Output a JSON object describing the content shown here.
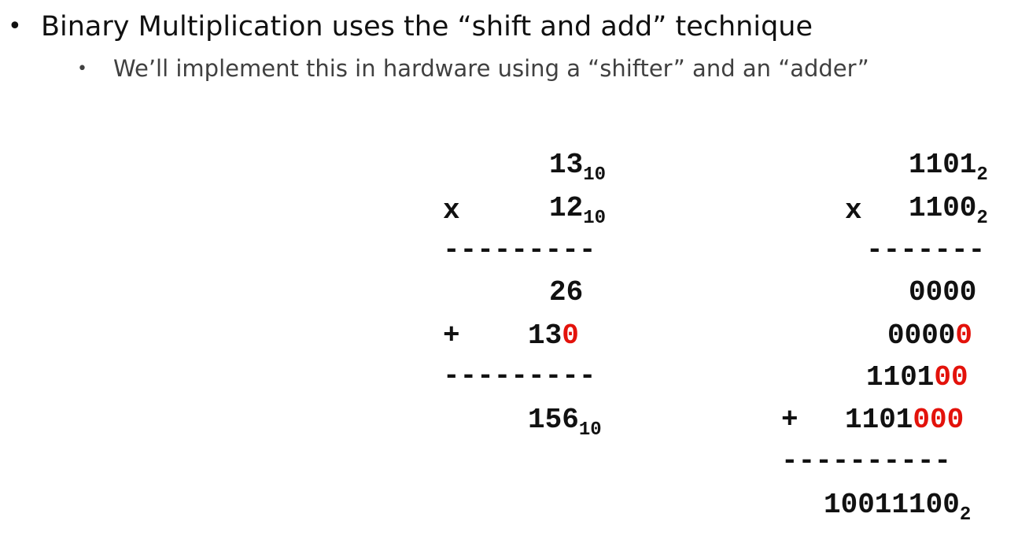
{
  "bullets": {
    "main": "Binary Multiplication uses the “shift and add” technique",
    "sub": "We’ll implement this in hardware using a “shifter” and an “adder”"
  },
  "decimal": {
    "multiplicand": "13",
    "multiplicand_base": "10",
    "times_sign": "x",
    "multiplier": "12",
    "multiplier_base": "10",
    "rule1": "---------",
    "partial1": "26",
    "plus_sign": "+",
    "partial2_digits": "13",
    "partial2_shift": "0",
    "rule2": "---------",
    "result": "156",
    "result_base": "10"
  },
  "binary": {
    "multiplicand": "1101",
    "multiplicand_base": "2",
    "times_sign": "x",
    "multiplier": "1100",
    "multiplier_base": "2",
    "rule1": "-------",
    "partial1": "0000",
    "partial2_digits": "0000",
    "partial2_shift": "0",
    "partial3_digits": "1101",
    "partial3_shift": "00",
    "plus_sign": "+",
    "partial4_digits": "1101",
    "partial4_shift": "000",
    "rule2": "----------",
    "result": "10011100",
    "result_base": "2"
  },
  "colors": {
    "text": "#111111",
    "subtext": "#404040",
    "shift_highlight": "#e3120b"
  }
}
